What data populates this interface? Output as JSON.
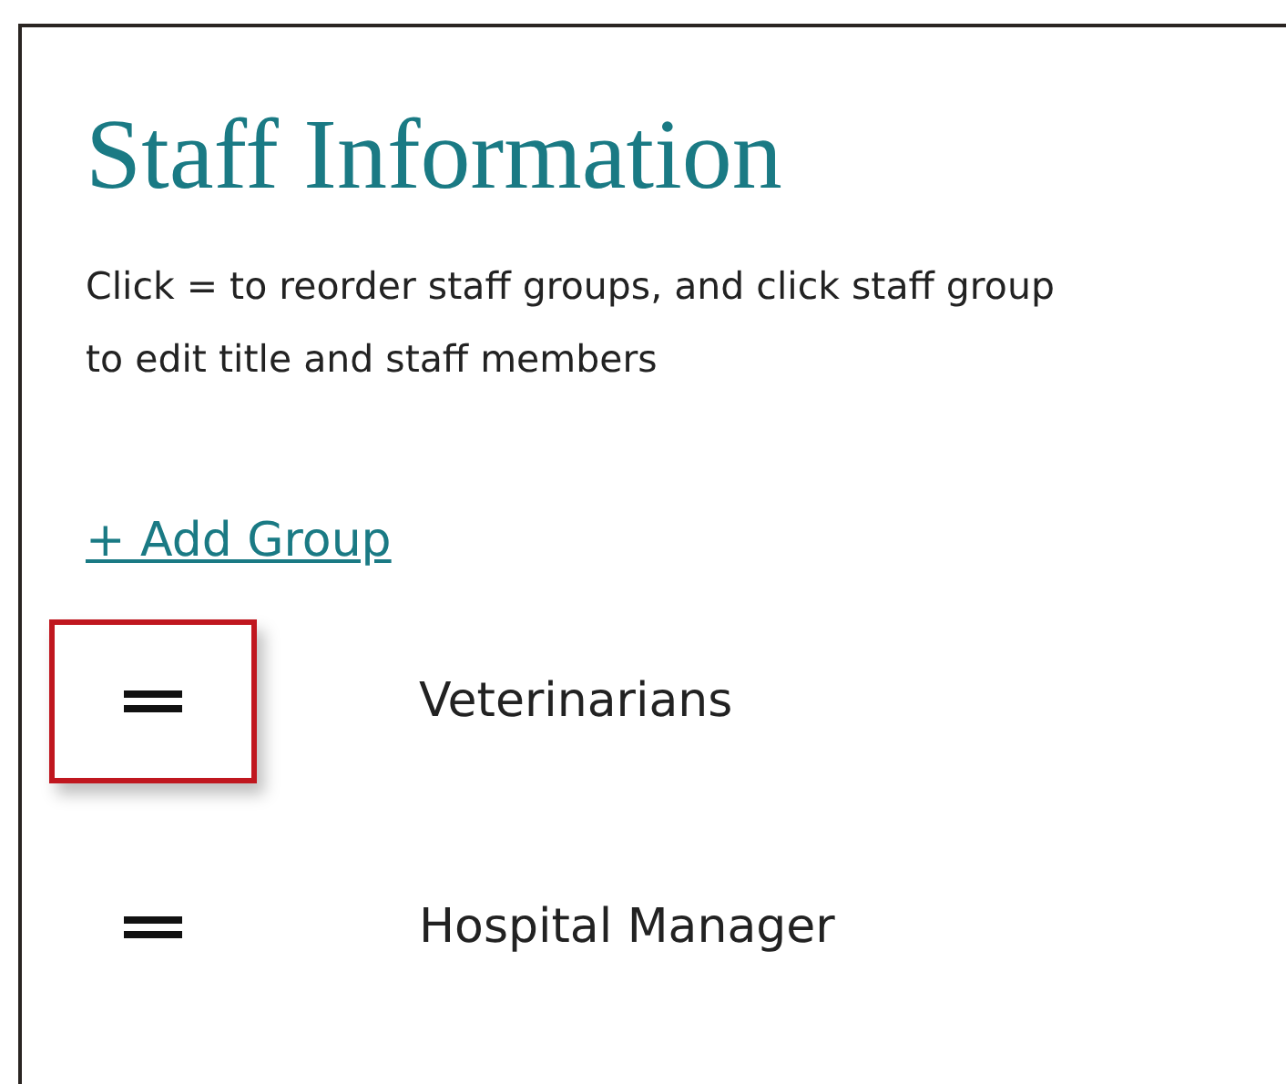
{
  "title": "Staff Information",
  "instructions": [
    "Click = to reorder staff groups, and click staff group",
    "to edit title and staff members"
  ],
  "add_link": "+ Add Group",
  "groups": [
    {
      "name": "Veterinarians",
      "highlighted": true
    },
    {
      "name": "Hospital Manager",
      "highlighted": false
    }
  ]
}
